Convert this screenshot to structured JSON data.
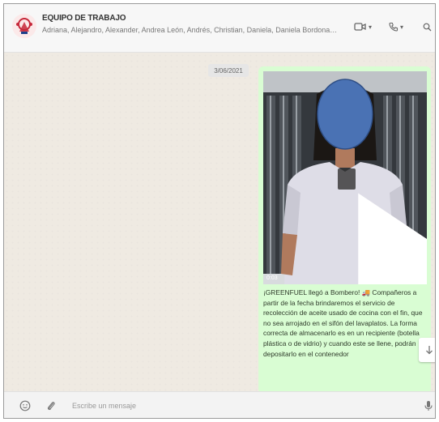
{
  "header": {
    "group_name": "EQUIPO DE TRABAJO",
    "members": "Adriana, Alejandro, Alexander, Andrea León, Andrés, Christian, Daniela, Daniela Bordonaro, ...",
    "avatar_icon": "group-logo-icon",
    "video_call_icon": "video-camera-icon",
    "voice_call_icon": "phone-icon",
    "search_icon": "search-icon",
    "chevron": "▾"
  },
  "chat": {
    "date_chip": "3/06/2021",
    "message": {
      "video_duration": "0:03",
      "caption": "¡GREENFUEL llegó a Bombero! 🚚 Compañeros a partir de la fecha brindaremos el servicio de recolección de aceite usado de cocina con el fin, que no sea arrojado en el sifón del lavaplatos. La forma correcta de almacenarlo es en un recipiente (botella plástica o de vidrio) y cuando este se llene, podrán depositarlo en el contenedor"
    },
    "scroll_down_icon": "arrow-down-icon"
  },
  "composer": {
    "emoji_icon": "emoji-icon",
    "attach_icon": "paperclip-icon",
    "placeholder": "Escribe un mensaje",
    "mic_icon": "microphone-icon"
  },
  "colors": {
    "bubble": "#d9fdd3",
    "chat_background": "#efeae2",
    "header": "#f7f7f7",
    "face_blur": "#4a72b4"
  }
}
